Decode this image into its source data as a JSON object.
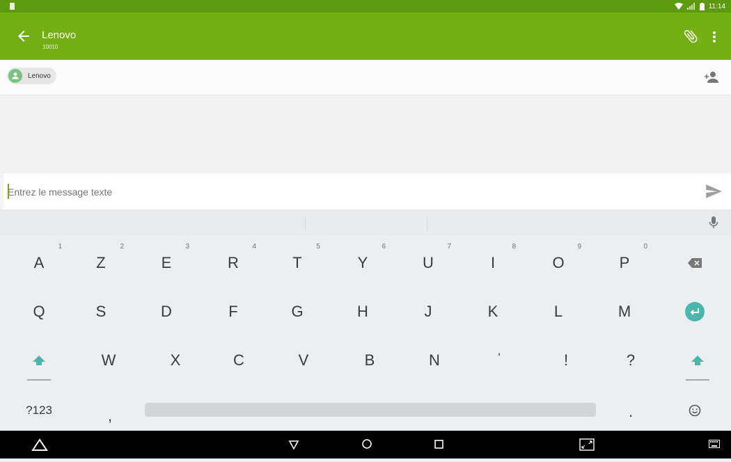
{
  "status_bar": {
    "time": "11:14",
    "icons": [
      "sim-card-icon",
      "wifi-icon",
      "signal-icon",
      "battery-icon"
    ]
  },
  "app_bar": {
    "title": "Lenovo",
    "subtitle": "10010",
    "color": "#73ae12",
    "icons": [
      "back-arrow-icon",
      "paperclip-icon",
      "more-vert-icon"
    ]
  },
  "recipient": {
    "chip_label": "Lenovo",
    "avatar_color": "#7cc383"
  },
  "compose": {
    "placeholder": "Entrez le message texte"
  },
  "keyboard": {
    "row1": [
      {
        "label": "A",
        "hint": "1"
      },
      {
        "label": "Z",
        "hint": "2"
      },
      {
        "label": "E",
        "hint": "3"
      },
      {
        "label": "R",
        "hint": "4"
      },
      {
        "label": "T",
        "hint": "5"
      },
      {
        "label": "Y",
        "hint": "6"
      },
      {
        "label": "U",
        "hint": "7"
      },
      {
        "label": "I",
        "hint": "8"
      },
      {
        "label": "O",
        "hint": "9"
      },
      {
        "label": "P",
        "hint": "0"
      }
    ],
    "row2": [
      "Q",
      "S",
      "D",
      "F",
      "G",
      "H",
      "J",
      "K",
      "L",
      "M"
    ],
    "row3": [
      "W",
      "X",
      "C",
      "V",
      "B",
      "N",
      "'",
      "!",
      "?"
    ],
    "symbols_label": "?123",
    "comma_label": ",",
    "period_label": ".",
    "accent_color": "#4db6ac"
  }
}
